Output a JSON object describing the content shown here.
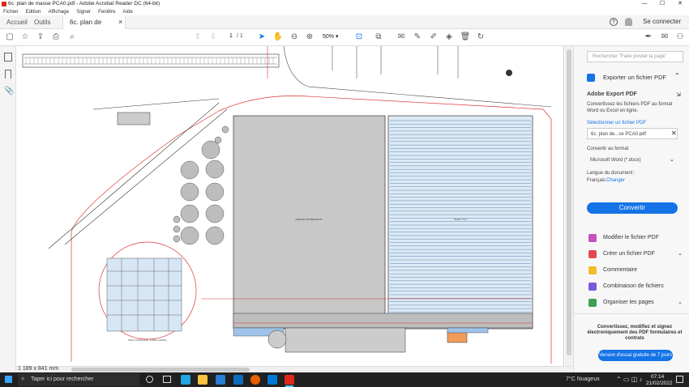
{
  "window": {
    "title": "6c. plan de masse PCA0.pdf - Adobe Acrobat Reader DC (64-bit)",
    "minimize": "—",
    "maximize": "☐",
    "close": "✕"
  },
  "menu": [
    "Fichier",
    "Edition",
    "Affichage",
    "Signer",
    "Fenêtre",
    "Aide"
  ],
  "tabs": {
    "home": "Accueil",
    "tools": "Outils",
    "doc": "6c. plan de masse PCA0...",
    "close": "×"
  },
  "header": {
    "signin": "Se connecter",
    "help_icon": "question-icon",
    "bell_icon": "bell-icon"
  },
  "toolbar": {
    "page_current": "1",
    "page_total": "/ 1",
    "zoom": "50%"
  },
  "plan": {
    "building_left_label": "SURFACE D'EXTENSION HT",
    "building_right_label": "HALLE n°3 A\nSURFACE : 0 M²",
    "scale_text": "1 189 x 841 mm",
    "detail_label": "Détail 4 toiture santé - échelle 1/100ème"
  },
  "right_panel": {
    "search_placeholder": "Rechercher \"Faire pivoter la page\"",
    "export_title": "Exporter un fichier PDF",
    "export_service": "Adobe Export PDF",
    "export_desc": "Convertissez les fichiers PDF au format Word ou Excel en ligne.",
    "select_file_link": "Sélectionner un fichier PDF",
    "file_name": "6c. plan de...se PCA0.pdf",
    "convert_to_label": "Convertir au format",
    "format_selected": "Microsoft Word (*.docx)",
    "doc_language_label": "Langue du document :",
    "language_value": "Français",
    "change_link": "Changer",
    "convert_button": "Convertir",
    "tools": [
      {
        "label": "Modifier le fichier PDF",
        "color": "#c94fbd"
      },
      {
        "label": "Créer un fichier PDF",
        "color": "#e34850"
      },
      {
        "label": "Commentaire",
        "color": "#f1bd2b"
      },
      {
        "label": "Combinaison de fichiers",
        "color": "#7b58d9"
      },
      {
        "label": "Organiser les pages",
        "color": "#3aa14f"
      }
    ],
    "promo_text": "Convertissez, modifiez et signez électroniquement des PDF formulaires et contrats",
    "trial_button": "Version d'essai gratuite de 7 jours"
  },
  "taskbar": {
    "search_placeholder": "Taper ici pour rechercher",
    "weather": "7°C  Nuageux",
    "time": "07:14",
    "date": "21/02/2022"
  }
}
